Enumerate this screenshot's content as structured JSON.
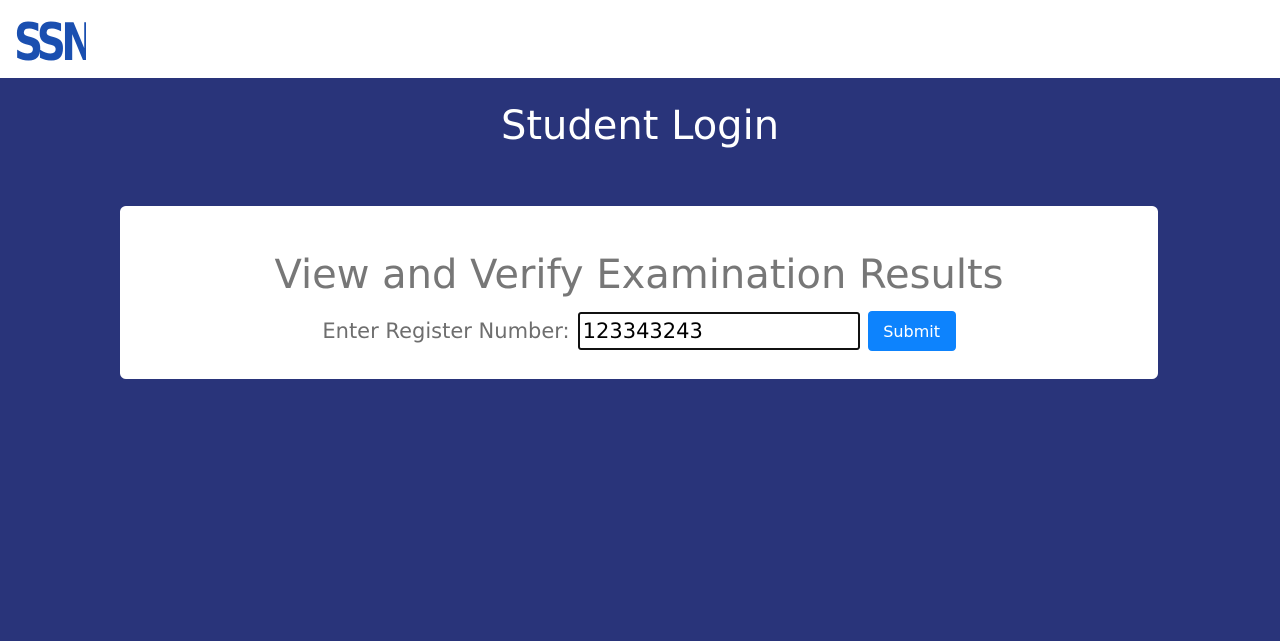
{
  "header": {
    "logo_text": "SSN"
  },
  "page": {
    "title": "Student Login"
  },
  "card": {
    "heading": "View and Verify Examination Results",
    "register_label": "Enter Register Number:",
    "register_value": "123343243",
    "submit_label": "Submit"
  },
  "colors": {
    "brand": "#1a4fb0",
    "background": "#29347a",
    "submit": "#0d83fd"
  }
}
